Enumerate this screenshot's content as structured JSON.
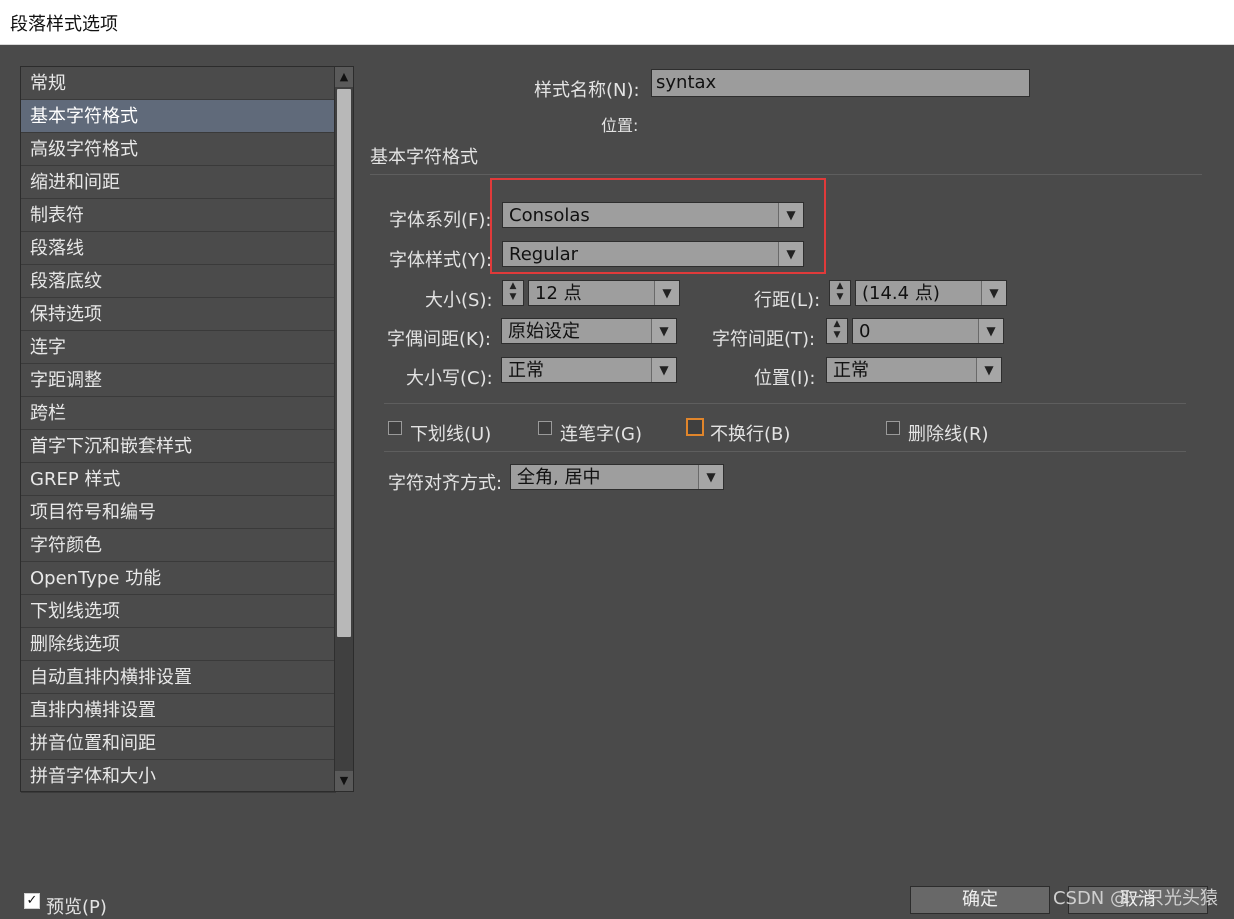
{
  "window": {
    "title": "段落样式选项"
  },
  "sidebar": {
    "items": [
      {
        "label": "常规"
      },
      {
        "label": "基本字符格式"
      },
      {
        "label": "高级字符格式"
      },
      {
        "label": "缩进和间距"
      },
      {
        "label": "制表符"
      },
      {
        "label": "段落线"
      },
      {
        "label": "段落底纹"
      },
      {
        "label": "保持选项"
      },
      {
        "label": "连字"
      },
      {
        "label": "字距调整"
      },
      {
        "label": "跨栏"
      },
      {
        "label": "首字下沉和嵌套样式"
      },
      {
        "label": "GREP 样式"
      },
      {
        "label": "项目符号和编号"
      },
      {
        "label": "字符颜色"
      },
      {
        "label": "OpenType 功能"
      },
      {
        "label": "下划线选项"
      },
      {
        "label": "删除线选项"
      },
      {
        "label": "自动直排内横排设置"
      },
      {
        "label": "直排内横排设置"
      },
      {
        "label": "拼音位置和间距"
      },
      {
        "label": "拼音字体和大小"
      }
    ],
    "selected_index": 1
  },
  "header": {
    "style_name_label": "样式名称(N):",
    "style_name_value": "syntax",
    "position_label": "位置:",
    "section_title": "基本字符格式"
  },
  "form": {
    "font_family_label": "字体系列(F):",
    "font_family_value": "Consolas",
    "font_style_label": "字体样式(Y):",
    "font_style_value": "Regular",
    "size_label": "大小(S):",
    "size_value": "12 点",
    "leading_label": "行距(L):",
    "leading_value": "(14.4 点)",
    "kerning_label": "字偶间距(K):",
    "kerning_value": "原始设定",
    "tracking_label": "字符间距(T):",
    "tracking_value": "0",
    "case_label": "大小写(C):",
    "case_value": "正常",
    "position_label": "位置(I):",
    "position_value": "正常"
  },
  "checkboxes": {
    "underline": "下划线(U)",
    "ligatures": "连笔字(G)",
    "no_break": "不换行(B)",
    "strikethrough": "删除线(R)"
  },
  "alignment": {
    "label": "字符对齐方式:",
    "value": "全角, 居中"
  },
  "footer": {
    "preview_label": "预览(P)",
    "ok_label": "确定",
    "cancel_label": "取消",
    "watermark": "CSDN @一只光头猿"
  },
  "colors": {
    "highlight_box": "#e03a3a",
    "orange_checkbox": "#e0852b"
  }
}
